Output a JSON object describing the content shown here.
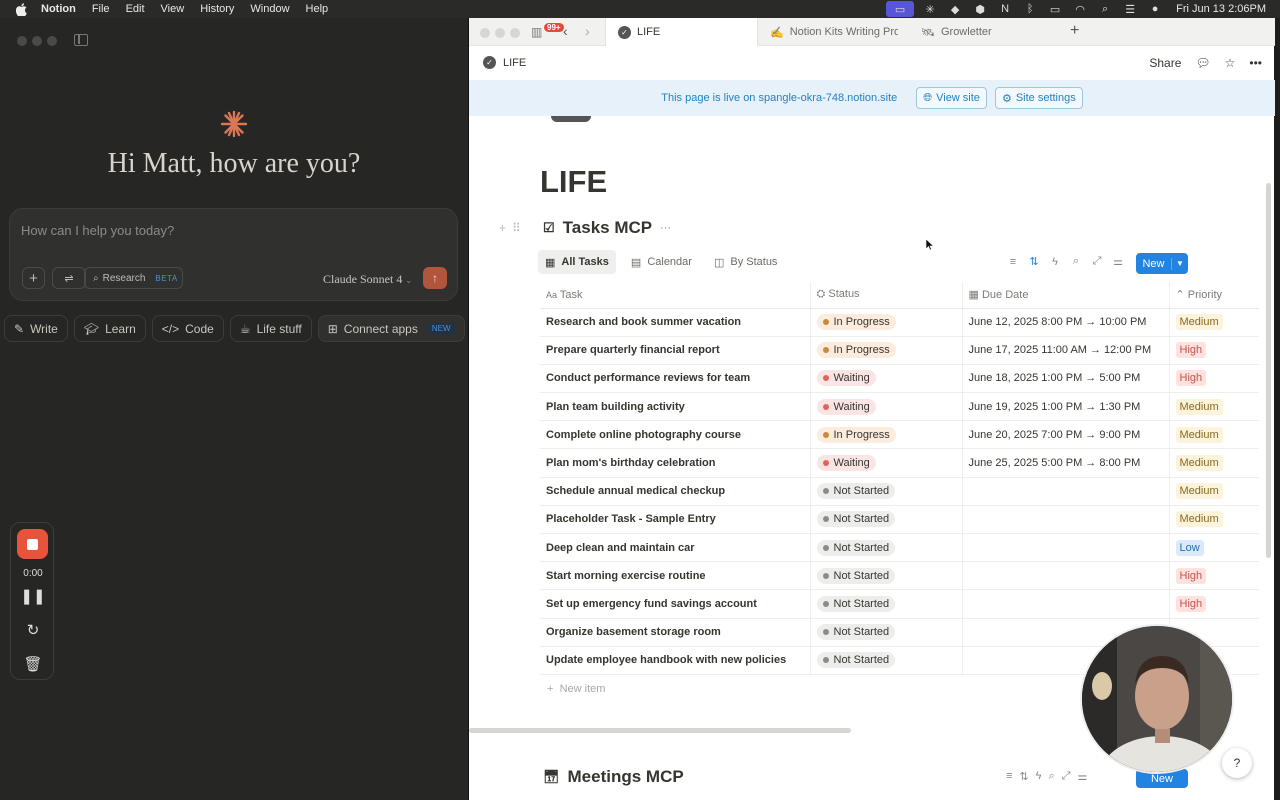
{
  "menubar": {
    "app": "Notion",
    "items": [
      "File",
      "Edit",
      "View",
      "History",
      "Window",
      "Help"
    ],
    "clock": "Fri Jun 13  2:06PM"
  },
  "claude": {
    "greeting": "Hi Matt, how are you?",
    "input_placeholder": "How can I help you today?",
    "research_label": "Research",
    "beta_label": "BETA",
    "model_label": "Claude Sonnet 4",
    "chips": [
      "Write",
      "Learn",
      "Code",
      "Life stuff",
      "Connect apps"
    ],
    "new_label": "NEW",
    "recorder_time": "0:00"
  },
  "browser": {
    "badge": "99+",
    "tabs": [
      {
        "label": "LIFE"
      },
      {
        "label": "Notion Kits Writing Pro"
      },
      {
        "label": "Growletter"
      }
    ]
  },
  "notion": {
    "breadcrumb": "LIFE",
    "share_label": "Share",
    "banner_text": "This page is live on spangle-okra-748.notion.site",
    "view_site_label": "View site",
    "site_settings_label": "Site settings",
    "page_title": "LIFE",
    "db_title": "Tasks MCP",
    "views": [
      "All Tasks",
      "Calendar",
      "By Status"
    ],
    "new_label": "New",
    "columns": {
      "task": "Task",
      "status": "Status",
      "due": "Due Date",
      "priority": "Priority"
    },
    "rows": [
      {
        "task": "Research and book summer vacation",
        "status": "In Progress",
        "due": "June 12, 2025 8:00 PM → 10:00 PM",
        "priority": "Medium"
      },
      {
        "task": "Prepare quarterly financial report",
        "status": "In Progress",
        "due": "June 17, 2025 11:00 AM → 12:00 PM",
        "priority": "High"
      },
      {
        "task": "Conduct performance reviews for team",
        "status": "Waiting",
        "due": "June 18, 2025 1:00 PM → 5:00 PM",
        "priority": "High"
      },
      {
        "task": "Plan team building activity",
        "status": "Waiting",
        "due": "June 19, 2025 1:00 PM → 1:30 PM",
        "priority": "Medium"
      },
      {
        "task": "Complete online photography course",
        "status": "In Progress",
        "due": "June 20, 2025 7:00 PM → 9:00 PM",
        "priority": "Medium"
      },
      {
        "task": "Plan mom's birthday celebration",
        "status": "Waiting",
        "due": "June 25, 2025 5:00 PM → 8:00 PM",
        "priority": "Medium"
      },
      {
        "task": "Schedule annual medical checkup",
        "status": "Not Started",
        "due": "",
        "priority": "Medium"
      },
      {
        "task": "Placeholder Task - Sample Entry",
        "status": "Not Started",
        "due": "",
        "priority": "Medium"
      },
      {
        "task": "Deep clean and maintain car",
        "status": "Not Started",
        "due": "",
        "priority": "Low"
      },
      {
        "task": "Start morning exercise routine",
        "status": "Not Started",
        "due": "",
        "priority": "High"
      },
      {
        "task": "Set up emergency fund savings account",
        "status": "Not Started",
        "due": "",
        "priority": "High"
      },
      {
        "task": "Organize basement storage room",
        "status": "Not Started",
        "due": "",
        "priority": ""
      },
      {
        "task": "Update employee handbook with new policies",
        "status": "Not Started",
        "due": "",
        "priority": ""
      }
    ],
    "new_item_label": "New item",
    "db2_title": "Meetings MCP"
  },
  "colors": {
    "in_progress_bg": "#fbecdd",
    "in_progress_dot": "#c98a3d",
    "waiting_bg": "#fbe4e4",
    "waiting_dot": "#e16259",
    "not_started_bg": "#ededeb",
    "not_started_dot": "#8c8b88",
    "medium_bg": "#fbf3db",
    "medium_fg": "#8a6a1f",
    "high_bg": "#ffe2dd",
    "high_fg": "#c4554d",
    "low_bg": "#dbeafa",
    "low_fg": "#2b6cb0"
  }
}
